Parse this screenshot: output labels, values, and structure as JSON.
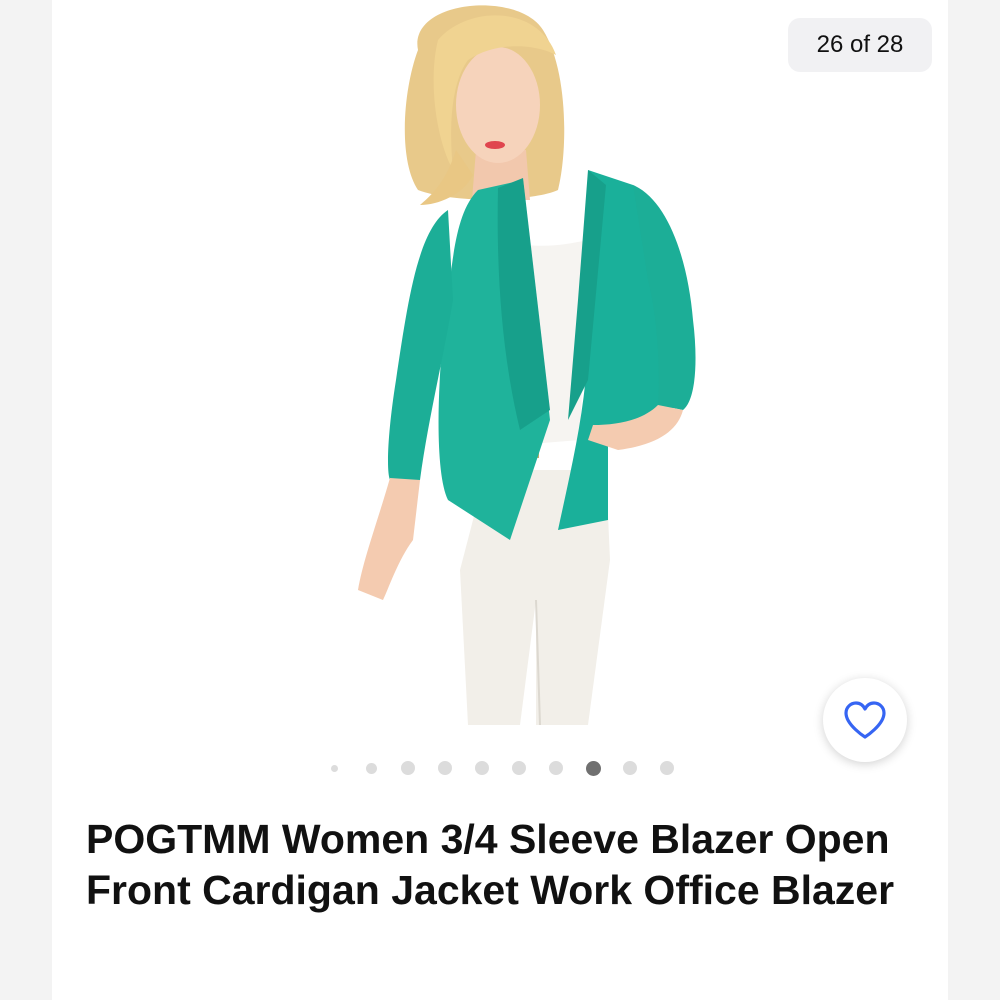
{
  "gallery": {
    "counter": "26 of 28",
    "total_dots": 10,
    "active_dot": 7,
    "image_alt": "Model wearing teal open front blazer with white top and white jeans"
  },
  "favorite": {
    "icon": "heart-outline-icon",
    "color": "#3665f3"
  },
  "product": {
    "title": "POGTMM Women 3/4 Sleeve Blazer Open Front Cardigan Jacket Work Office Blazer"
  },
  "colors": {
    "blazer": "#1fb39b",
    "accent": "#3665f3",
    "dot_active": "#707070"
  }
}
